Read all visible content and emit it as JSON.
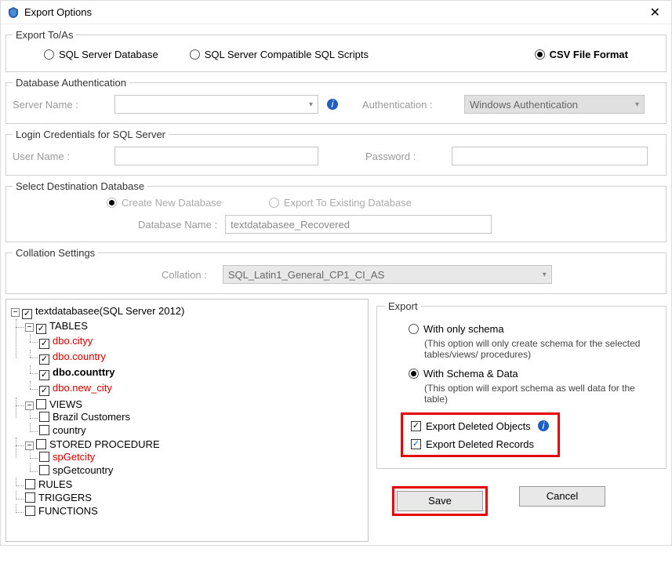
{
  "window": {
    "title": "Export Options"
  },
  "exportTo": {
    "legend": "Export To/As",
    "opt1": "SQL Server Database",
    "opt2": "SQL Server Compatible SQL Scripts",
    "opt3": "CSV File Format"
  },
  "dbAuth": {
    "legend": "Database Authentication",
    "serverLabel": "Server Name :",
    "authLabel": "Authentication :",
    "authValue": "Windows Authentication"
  },
  "login": {
    "legend": "Login Credentials for SQL Server",
    "userLabel": "User Name :",
    "passLabel": "Password :"
  },
  "dest": {
    "legend": "Select Destination Database",
    "createLabel": "Create New Database",
    "exportLabel": "Export To Existing Database",
    "dbNameLabel": "Database Name :",
    "dbNameValue": "textdatabasee_Recovered"
  },
  "collation": {
    "legend": "Collation Settings",
    "label": "Collation :",
    "value": "SQL_Latin1_General_CP1_CI_AS"
  },
  "tree": {
    "root": "textdatabasee(SQL Server 2012)",
    "tables": "TABLES",
    "t1": "dbo.cityy",
    "t2": "dbo.country",
    "t3": "dbo.counttry",
    "t4": "dbo.new_city",
    "views": "VIEWS",
    "v1": "Brazil Customers",
    "v2": "country",
    "sp": "STORED PROCEDURE",
    "sp1": "spGetcity",
    "sp2": "spGetcountry",
    "rules": "RULES",
    "triggers": "TRIGGERS",
    "functions": "FUNCTIONS"
  },
  "export": {
    "legend": "Export",
    "schemaOnly": "With only schema",
    "schemaOnlyDesc": "(This option will only create schema for the  selected tables/views/ procedures)",
    "schemaData": "With Schema & Data",
    "schemaDataDesc": "(This option will export schema as well data for the table)",
    "delObjects": "Export Deleted Objects",
    "delRecords": "Export Deleted Records"
  },
  "buttons": {
    "save": "Save",
    "cancel": "Cancel"
  }
}
